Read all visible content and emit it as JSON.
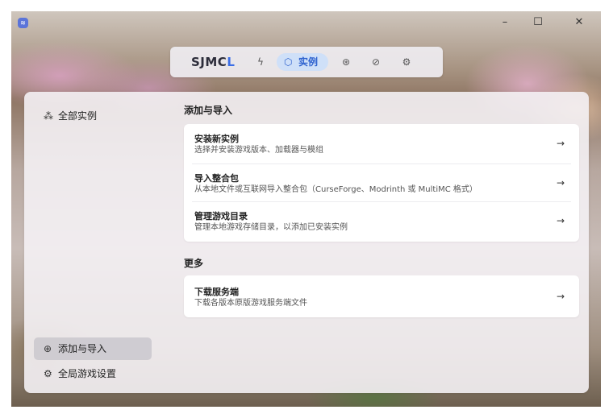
{
  "titlebar": {
    "logo_glyph": "≋",
    "minimize_glyph": "–",
    "maximize_glyph": "☐",
    "close_glyph": "✕"
  },
  "topnav": {
    "brand_main": "SJMC",
    "brand_accent": "L",
    "brand_accent_color": "#3b6ee6",
    "items": [
      {
        "icon": "bolt-icon",
        "glyph": "ϟ"
      },
      {
        "icon": "cube-icon",
        "glyph": "⬡",
        "label": "实例",
        "active": true
      },
      {
        "icon": "account-icon",
        "glyph": "⊛"
      },
      {
        "icon": "compass-icon",
        "glyph": "⊘"
      },
      {
        "icon": "gear-icon",
        "glyph": "⚙"
      }
    ]
  },
  "sidebar": {
    "top_item": {
      "icon": "instances-icon",
      "glyph": "⁂",
      "label": "全部实例"
    },
    "bottom_items": [
      {
        "icon": "add-circle-icon",
        "glyph": "⊕",
        "label": "添加与导入",
        "active": true
      },
      {
        "icon": "gear-icon",
        "glyph": "⚙",
        "label": "全局游戏设置"
      }
    ]
  },
  "main": {
    "sections": [
      {
        "title": "添加与导入",
        "rows": [
          {
            "title": "安装新实例",
            "desc": "选择并安装游戏版本、加载器与模组",
            "arrow": "→"
          },
          {
            "title": "导入整合包",
            "desc": "从本地文件或互联网导入整合包（CurseForge、Modrinth 或 MultiMC 格式）",
            "arrow": "→"
          },
          {
            "title": "管理游戏目录",
            "desc": "管理本地游戏存储目录，以添加已安装实例",
            "arrow": "→"
          }
        ]
      },
      {
        "title": "更多",
        "rows": [
          {
            "title": "下载服务端",
            "desc": "下载各版本原版游戏服务端文件",
            "arrow": "→"
          }
        ]
      }
    ]
  }
}
